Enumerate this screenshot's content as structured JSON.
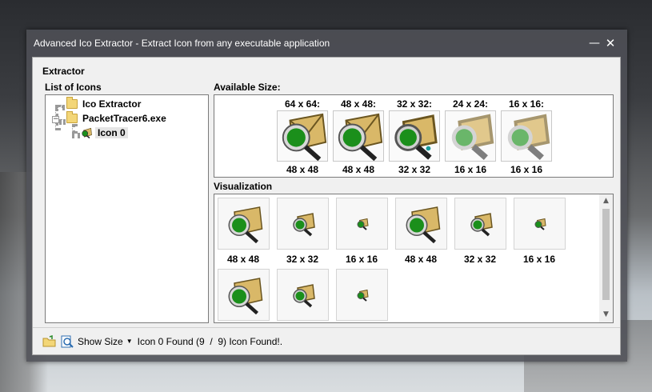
{
  "window": {
    "title": "Advanced Ico Extractor - Extract Icon from any executable application",
    "minimize_glyph": "—",
    "close_glyph": "✕"
  },
  "group": {
    "label": "Extractor"
  },
  "tree": {
    "heading": "List of Icons",
    "nodes": [
      {
        "label": "Ico Extractor",
        "type": "folder"
      },
      {
        "label": "PacketTracer6.exe",
        "type": "folder",
        "expanded": true
      },
      {
        "label": "Icon 0",
        "type": "icon",
        "selected": true
      }
    ]
  },
  "available": {
    "heading": "Available Size:",
    "items": [
      {
        "top_label": "64 x 64:",
        "bottom_label": "48 x 48"
      },
      {
        "top_label": "48 x 48:",
        "bottom_label": "48 x 48"
      },
      {
        "top_label": "32 x 32:",
        "bottom_label": "32 x 32"
      },
      {
        "top_label": "24 x 24:",
        "bottom_label": "16 x 16"
      },
      {
        "top_label": "16 x 16:",
        "bottom_label": "16 x 16"
      }
    ]
  },
  "visualization": {
    "heading": "Visualization",
    "row1": [
      "48 x 48",
      "32 x 32",
      "16 x 16",
      "48 x 48",
      "32 x 32",
      "16 x 16"
    ],
    "row2_count": 3
  },
  "status": {
    "show_size_label": "Show Size",
    "message": "Icon 0 Found (9  /  9) Icon Found!."
  },
  "scrollbar": {
    "up_glyph": "▲",
    "down_glyph": "▼"
  },
  "colors": {
    "envelope": "#d9b868",
    "grid_green": "#1b8f1b",
    "accent_dark": "#2d2d2d"
  }
}
